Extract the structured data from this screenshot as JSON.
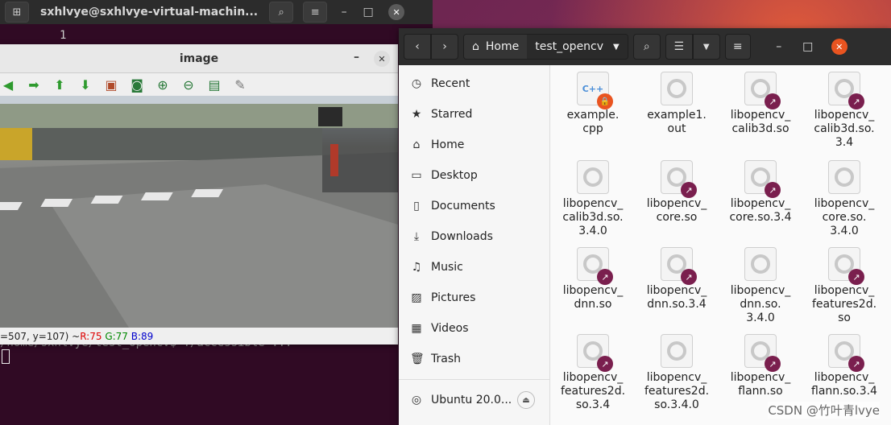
{
  "terminal": {
    "title": "sxhlvye@sxhlvye-virtual-machin...",
    "line_top": "1",
    "line_path": "/home/sxhlvye/test_opencv$ ./accessible  ..."
  },
  "image_window": {
    "title": "image",
    "status_prefix": "=507, y=107) ~ ",
    "r": "R:75",
    "g": "G:77",
    "b": "B:89",
    "toolbar_icons": [
      "arrow-left-icon",
      "arrow-right-icon",
      "arrow-up-icon",
      "arrow-down-icon",
      "picture-icon",
      "image-view-icon",
      "zoom-in-icon",
      "zoom-out-icon",
      "save-icon",
      "settings-brush-icon"
    ]
  },
  "files": {
    "breadcrumb": [
      "Home",
      "test_opencv"
    ],
    "sidebar": [
      {
        "label": "Recent",
        "icon": "clock-icon"
      },
      {
        "label": "Starred",
        "icon": "star-icon"
      },
      {
        "label": "Home",
        "icon": "home-icon"
      },
      {
        "label": "Desktop",
        "icon": "desktop-icon"
      },
      {
        "label": "Documents",
        "icon": "documents-icon"
      },
      {
        "label": "Downloads",
        "icon": "downloads-icon"
      },
      {
        "label": "Music",
        "icon": "music-icon"
      },
      {
        "label": "Pictures",
        "icon": "pictures-icon"
      },
      {
        "label": "Videos",
        "icon": "videos-icon"
      },
      {
        "label": "Trash",
        "icon": "trash-icon"
      },
      {
        "label": "Ubuntu 20.0...",
        "icon": "disc-icon"
      }
    ],
    "items": [
      {
        "name": "example.\ncpp",
        "type": "cpp",
        "badge": "lock"
      },
      {
        "name": "example1.\nout",
        "type": "exec",
        "badge": ""
      },
      {
        "name": "libopencv_\ncalib3d.so",
        "type": "exec",
        "badge": "link"
      },
      {
        "name": "libopencv_\ncalib3d.so.\n3.4",
        "type": "exec",
        "badge": "link"
      },
      {
        "name": "libopencv_\ncalib3d.so.\n3.4.0",
        "type": "exec",
        "badge": ""
      },
      {
        "name": "libopencv_\ncore.so",
        "type": "exec",
        "badge": "link"
      },
      {
        "name": "libopencv_\ncore.so.3.4",
        "type": "exec",
        "badge": "link"
      },
      {
        "name": "libopencv_\ncore.so.\n3.4.0",
        "type": "exec",
        "badge": ""
      },
      {
        "name": "libopencv_\ndnn.so",
        "type": "exec",
        "badge": "link"
      },
      {
        "name": "libopencv_\ndnn.so.3.4",
        "type": "exec",
        "badge": "link"
      },
      {
        "name": "libopencv_\ndnn.so.\n3.4.0",
        "type": "exec",
        "badge": ""
      },
      {
        "name": "libopencv_\nfeatures2d.\nso",
        "type": "exec",
        "badge": "link"
      },
      {
        "name": "libopencv_\nfeatures2d.\nso.3.4",
        "type": "exec",
        "badge": "link"
      },
      {
        "name": "libopencv_\nfeatures2d.\nso.3.4.0",
        "type": "exec",
        "badge": ""
      },
      {
        "name": "libopencv_\nflann.so",
        "type": "exec",
        "badge": "link"
      },
      {
        "name": "libopencv_\nflann.so.3.4",
        "type": "exec",
        "badge": "link"
      }
    ]
  },
  "watermark": "CSDN @竹叶青lvye"
}
